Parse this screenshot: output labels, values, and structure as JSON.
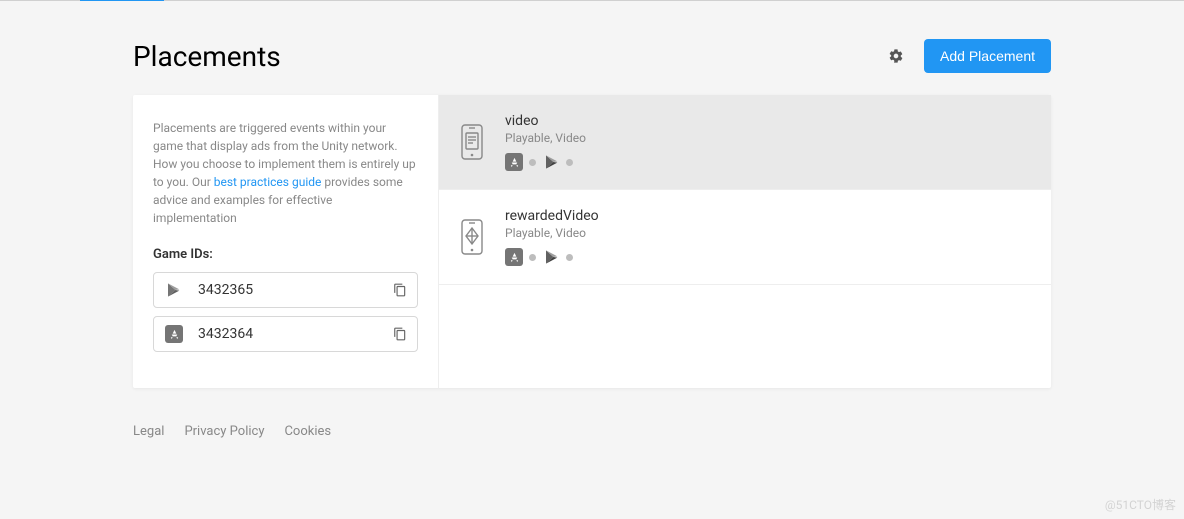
{
  "header": {
    "title": "Placements",
    "add_button": "Add Placement"
  },
  "sidebar": {
    "description_prefix": "Placements are triggered events within your game that display ads from the Unity network. How you choose to implement them is entirely up to you. Our ",
    "description_link": "best practices guide",
    "description_suffix": " provides some advice and examples for effective implementation",
    "game_ids_label": "Game IDs:",
    "ids": [
      {
        "store": "google",
        "value": "3432365"
      },
      {
        "store": "apple",
        "value": "3432364"
      }
    ]
  },
  "placements": [
    {
      "name": "video",
      "subtitle": "Playable, Video",
      "selected": true
    },
    {
      "name": "rewardedVideo",
      "subtitle": "Playable, Video",
      "selected": false
    }
  ],
  "footer": {
    "legal": "Legal",
    "privacy": "Privacy Policy",
    "cookies": "Cookies"
  },
  "watermark": "@51CTO博客"
}
